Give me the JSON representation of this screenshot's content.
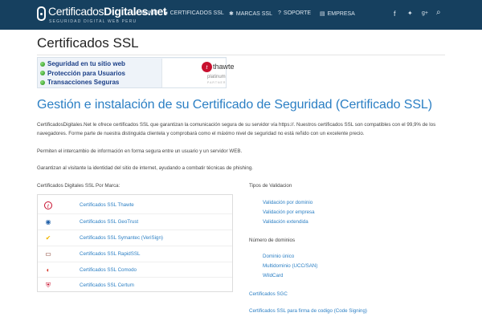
{
  "brand": {
    "logo_text_a": "Certificados",
    "logo_text_b": "Digitales.net",
    "tagline": "SEGURIDAD DIGITAL WEB PERU"
  },
  "nav": {
    "items": [
      {
        "label": "HOME",
        "icon": "home-icon",
        "glyph": "⌂"
      },
      {
        "label": "CERTIFICADOS SSL",
        "icon": "lock-icon",
        "glyph": "🔒"
      },
      {
        "label": "MARCAS SSL",
        "icon": "gear-icon",
        "glyph": "✱"
      },
      {
        "label": "SOPORTE",
        "icon": "question-icon",
        "glyph": "?"
      },
      {
        "label": "EMPRESA",
        "icon": "document-icon",
        "glyph": "▤"
      }
    ],
    "social": [
      {
        "icon": "facebook-icon",
        "glyph": "f"
      },
      {
        "icon": "twitter-icon",
        "glyph": "🐦"
      },
      {
        "icon": "googleplus-icon",
        "glyph": "g+"
      },
      {
        "icon": "search-icon",
        "glyph": "⌕"
      }
    ]
  },
  "page": {
    "title": "Certificados SSL",
    "banner": {
      "items": [
        "Seguridad en tu sitio web",
        "Protección para Usuarios",
        "Transacciones Seguras"
      ],
      "logo_word": "thawte",
      "logo_letter": "t",
      "logo_tier": "platinum",
      "logo_partner": "PARTNER"
    },
    "heading": "Gestión e instalación de su Certificado de Seguridad (Certificado SSL)",
    "paragraphs": [
      "CertificadosDigitales.Net le ofrece certificados SSL que garantizan la comunicación segura de su servidor vía https://.  Nuestros certificados SSL son compatibles con el 99,9% de los navegadores. Forme parte de nuestra distinguida clientela y comprobará como el máximo nivel de seguridad no está reñido con un excelente precio.",
      "Permiten el intercambio de información en forma segura entre un usuario y un servidor WEB.",
      "Garantizan al visitante la identidad del sitio de internet, ayudando a combatir técnicas de phishing."
    ],
    "brands_title": "Certificados Digitales SSL Por Marca:",
    "brands": [
      {
        "label": "Certificados SSL Thawte",
        "icon": "thawte-icon",
        "glyph": "t",
        "color": "#c8102e"
      },
      {
        "label": "Certificados SSL GeoTrust",
        "icon": "geotrust-icon",
        "glyph": "◉",
        "color": "#1f5fa8"
      },
      {
        "label": "Certificados SSL Symantec (VeriSign)",
        "icon": "symantec-icon",
        "glyph": "✔",
        "color": "#f2b600"
      },
      {
        "label": "Certificados SSL RapidSSL",
        "icon": "rapidssl-icon",
        "glyph": "▭",
        "color": "#7a2a1a"
      },
      {
        "label": "Certificados SSL Comodo",
        "icon": "comodo-icon",
        "glyph": "◐",
        "color": "#d63b2f"
      },
      {
        "label": "Certificados SSL Certum",
        "icon": "certum-icon",
        "glyph": "⛨",
        "color": "#c8102e"
      }
    ],
    "validation": {
      "title": "Tipos de Validacion",
      "links": [
        "Validación por dominio",
        "Validación por empresa",
        "Validación extendida"
      ]
    },
    "domains": {
      "title": "Número de dominios",
      "links": [
        "Dominio único",
        "Multidominio (UCC/SAN)",
        "WildCard"
      ]
    },
    "extra_links": [
      "Certificados SGC",
      "Certificados SSL para firma de codigo (Code Signing)"
    ]
  },
  "colors": {
    "topbar": "#16405f",
    "link": "#2b7fc4",
    "banner_text": "#1b3f87"
  }
}
